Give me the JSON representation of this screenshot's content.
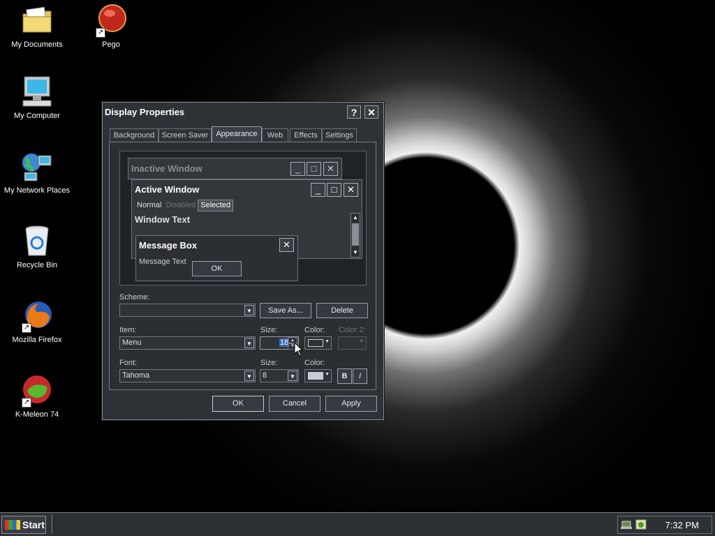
{
  "desktop": {
    "icons": [
      {
        "label": "My Documents"
      },
      {
        "label": "Pego"
      },
      {
        "label": "My Computer"
      },
      {
        "label": "My Network Places"
      },
      {
        "label": "Recycle Bin"
      },
      {
        "label": "Mozilla Firefox"
      },
      {
        "label": "K-Meleon 74"
      }
    ]
  },
  "dialog": {
    "title": "Display Properties",
    "help_icon": "?",
    "close_icon": "✕",
    "tabs": [
      "Background",
      "Screen Saver",
      "Appearance",
      "Web",
      "Effects",
      "Settings"
    ],
    "active_tab": "Appearance",
    "preview": {
      "inactive_title": "Inactive Window",
      "active_title": "Active Window",
      "menu_items": [
        "Normal",
        "Disabled",
        "Selected"
      ],
      "window_text": "Window Text",
      "message_box_title": "Message Box",
      "message_text": "Message Text",
      "ok_label": "OK"
    },
    "scheme": {
      "label": "Scheme:",
      "value": "",
      "save_as_label": "Save As...",
      "delete_label": "Delete"
    },
    "item": {
      "label": "Item:",
      "value": "Menu",
      "size_label": "Size:",
      "size_value": "18",
      "color_label": "Color:",
      "color2_label": "Color 2:"
    },
    "font": {
      "label": "Font:",
      "value": "Tahoma",
      "size_label": "Size:",
      "size_value": "8",
      "color_label": "Color:",
      "bold_label": "B",
      "italic_label": "I"
    },
    "buttons": {
      "ok": "OK",
      "cancel": "Cancel",
      "apply": "Apply"
    }
  },
  "taskbar": {
    "start_label": "Start",
    "clock": "7:32 PM"
  },
  "colors": {
    "dialog_bg": "#2e3237",
    "selected_highlight": "#4a4e55"
  }
}
